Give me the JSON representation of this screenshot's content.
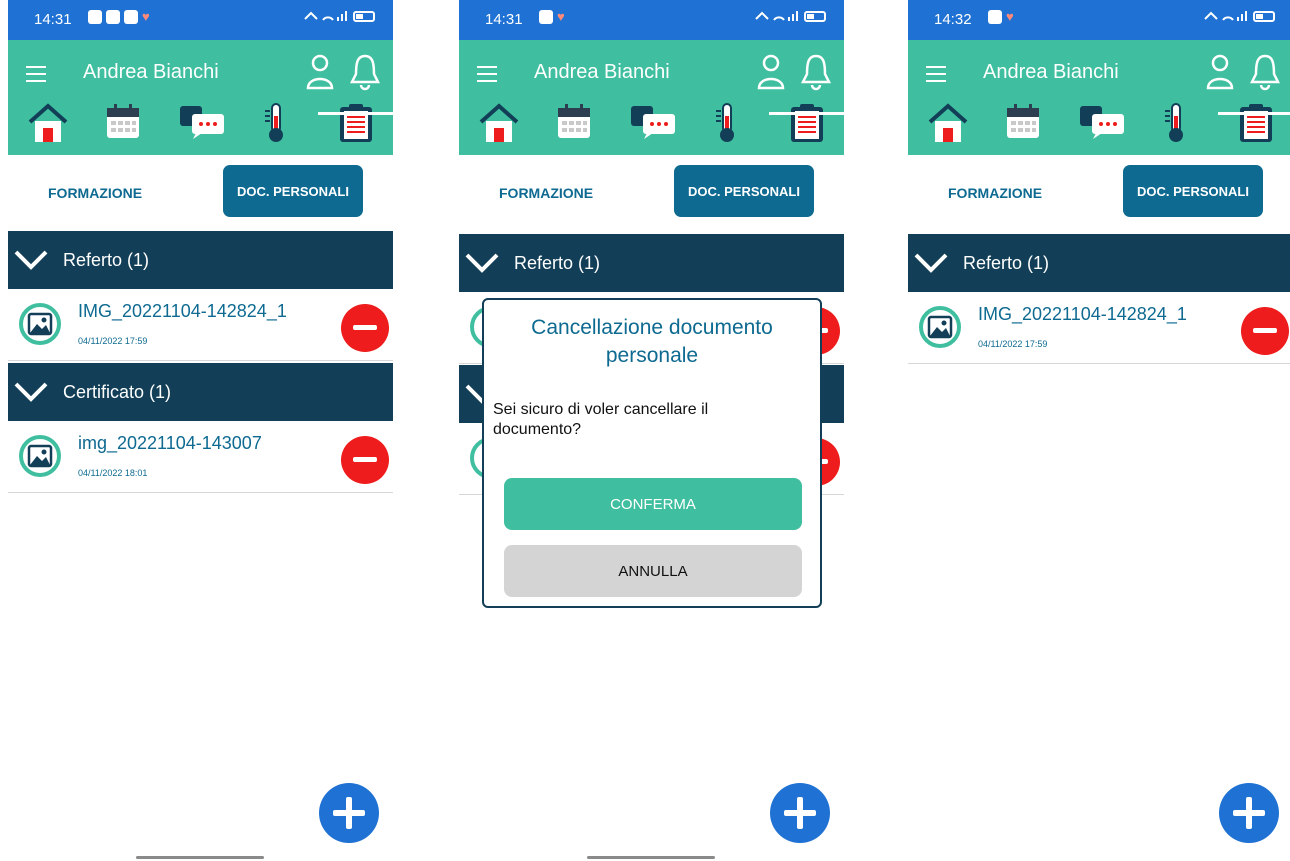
{
  "app": {
    "user_name": "Andrea Bianchi"
  },
  "tabs": {
    "formazione": "FORMAZIONE",
    "doc_personali": "DOC. PERSONALI"
  },
  "screens": [
    {
      "time": "14:31",
      "sections": [
        {
          "title": "Referto (1)",
          "file": "IMG_20221104-142824_1",
          "date": "04/11/2022 17:59"
        },
        {
          "title": "Certificato (1)",
          "file": "img_20221104-143007",
          "date": "04/11/2022 18:01"
        }
      ]
    },
    {
      "time": "14:31",
      "sections": [
        {
          "title": "Referto (1)"
        }
      ],
      "dialog": {
        "title": "Cancellazione documento personale",
        "message": "Sei sicuro di voler cancellare il documento?",
        "confirm": "CONFERMA",
        "cancel": "ANNULLA"
      }
    },
    {
      "time": "14:32",
      "sections": [
        {
          "title": "Referto (1)",
          "file": "IMG_20221104-142824_1",
          "date": "04/11/2022 17:59"
        }
      ]
    }
  ],
  "colors": {
    "status_bar": "#1f72d3",
    "header": "#3fbf9f",
    "primary": "#0e6a91",
    "section_bar": "#123f57",
    "delete": "#ee1c1c",
    "fab": "#1f72d3"
  },
  "icons": [
    "menu-icon",
    "user-icon",
    "bell-icon",
    "home-icon",
    "calendar-icon",
    "chat-icon",
    "thermometer-icon",
    "clipboard-icon",
    "chevron-down-icon",
    "image-file-icon",
    "remove-icon",
    "add-icon"
  ]
}
